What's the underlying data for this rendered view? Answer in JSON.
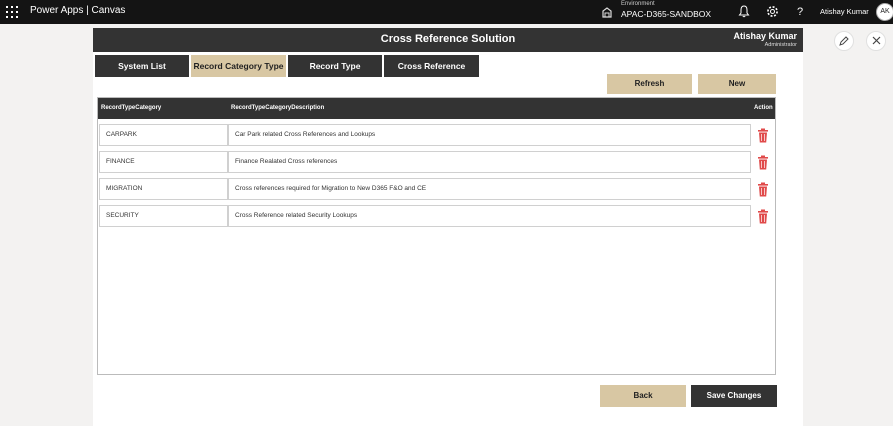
{
  "topbar": {
    "brand": "Power Apps  |  Canvas",
    "environment_label": "Environment",
    "environment_name": "APAC-D365-SANDBOX",
    "user_name": "Atishay Kumar",
    "avatar_initials": "AK"
  },
  "header": {
    "title": "Cross Reference Solution",
    "user_name": "Atishay Kumar",
    "user_role": "Administrator"
  },
  "tabs": [
    {
      "label": "System List"
    },
    {
      "label": "Record Category Type"
    },
    {
      "label": "Record Type"
    },
    {
      "label": "Cross Reference"
    }
  ],
  "actions": {
    "refresh": "Refresh",
    "new": "New",
    "back": "Back",
    "save": "Save Changes"
  },
  "grid": {
    "columns": [
      "RecordTypeCategory",
      "RecordTypeCategoryDescription",
      "Action"
    ],
    "rows": [
      {
        "category": "CARPARK",
        "description": "Car Park related Cross References and Lookups"
      },
      {
        "category": "FINANCE",
        "description": "Finance Realated Cross references"
      },
      {
        "category": "MIGRATION",
        "description": "Cross references required for Migration to New D365 F&O and CE"
      },
      {
        "category": "SECURITY",
        "description": "Cross Reference related Security Lookups"
      }
    ]
  },
  "colors": {
    "dark": "#333333",
    "tan": "#d8c7a3",
    "trash_red": "#e04a4a"
  },
  "icons": [
    "waffle-icon",
    "environment-icon",
    "bell-icon",
    "settings-icon",
    "help-icon",
    "trash-icon",
    "edit-icon",
    "close-icon"
  ]
}
